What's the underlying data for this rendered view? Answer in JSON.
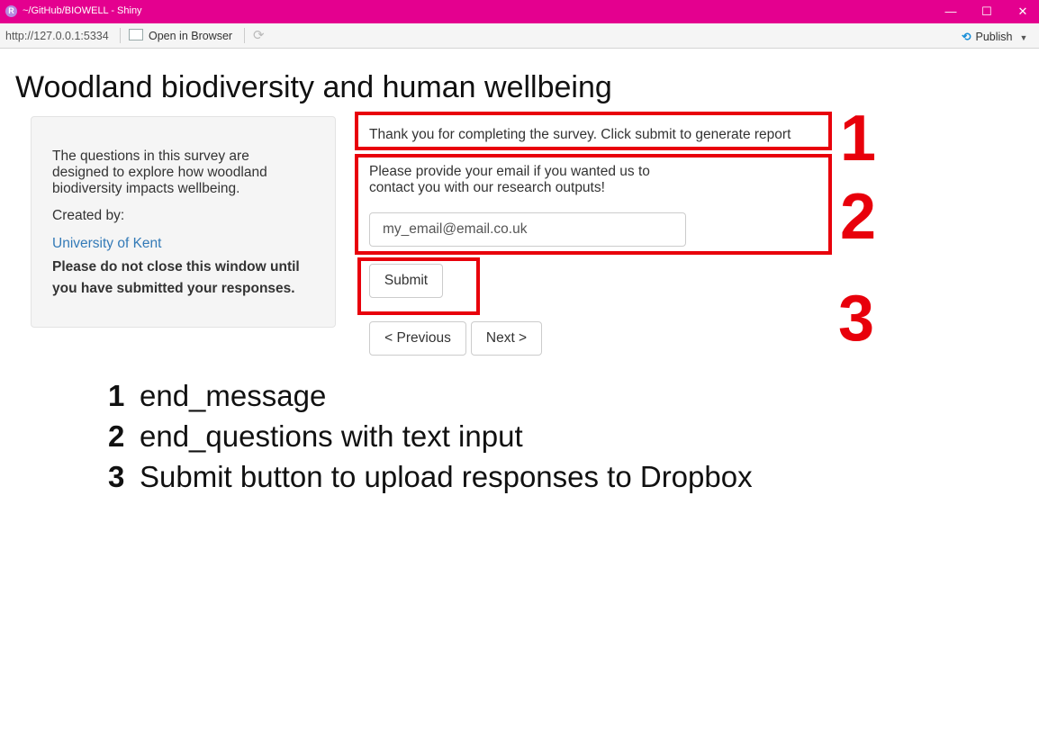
{
  "window": {
    "title": "~/GitHub/BIOWELL - Shiny",
    "icon_letter": "R",
    "minimize": "—",
    "maximize": "☐",
    "close": "✕"
  },
  "toolbar": {
    "url": "http://127.0.0.1:5334",
    "open_in_browser": "Open in Browser",
    "publish": "Publish"
  },
  "page": {
    "title": "Woodland biodiversity and human wellbeing"
  },
  "sidebar": {
    "intro": "The questions in this survey are designed to explore how woodland biodiversity impacts wellbeing.",
    "created_by": "Created by:",
    "link": "University of Kent",
    "warning": "Please do not close this window until you have submitted your responses."
  },
  "main": {
    "end_message": "Thank you for completing the survey. Click submit to generate report",
    "email_prompt": "Please provide your email if you wanted us to contact you with our research outputs!",
    "email_value": "my_email@email.co.uk",
    "submit_label": "Submit",
    "previous_label": "< Previous",
    "next_label": "Next >"
  },
  "annotations": {
    "box_numbers": [
      "1",
      "2",
      "3"
    ],
    "legend": [
      {
        "num": "1",
        "text": "end_message"
      },
      {
        "num": "2",
        "text": "end_questions with text input"
      },
      {
        "num": "3",
        "text": "Submit button to upload responses to Dropbox"
      }
    ],
    "color": "#e8000b"
  }
}
